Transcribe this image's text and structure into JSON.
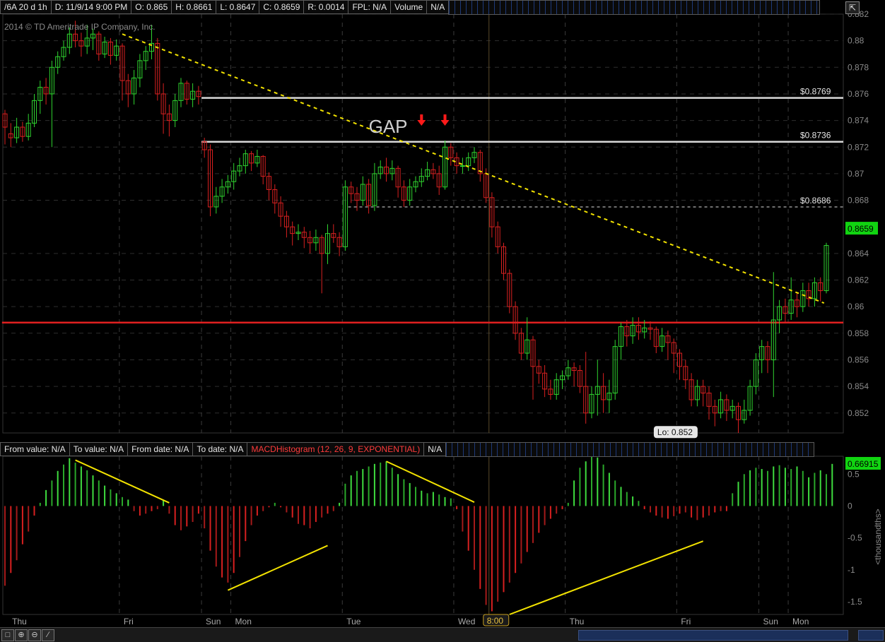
{
  "header": {
    "symbol": "/6A 20 d 1h",
    "date": "D: 11/9/14 9:00 PM",
    "open": "O: 0.865",
    "high": "H: 0.8661",
    "low": "L: 0.8647",
    "close": "C: 0.8659",
    "range": "R: 0.0014",
    "fpl": "FPL: N/A",
    "volume": "Volume",
    "volume_value": "N/A"
  },
  "copyright": "2014 © TD Ameritrade IP Company, Inc.",
  "lower_header": {
    "from_value": "From value: N/A",
    "to_value": "To value: N/A",
    "from_date": "From date: N/A",
    "to_date": "To date: N/A",
    "study": "MACDHistogram (12, 26, 9, EXPONENTIAL)",
    "na": "N/A"
  },
  "chart_data": [
    {
      "type": "candlestick",
      "price_axis": {
        "min": 0.8505,
        "max": 0.882,
        "ticks": [
          0.852,
          0.854,
          0.856,
          0.858,
          0.86,
          0.862,
          0.864,
          0.868,
          0.87,
          0.872,
          0.874,
          0.876,
          0.878,
          0.88,
          0.882
        ]
      },
      "last_price_label": "0.8659",
      "last_price": 0.8659,
      "x_labels": [
        {
          "label": "Thu",
          "i": 1
        },
        {
          "label": "Fri",
          "i": 20
        },
        {
          "label": "Sun",
          "i": 34
        },
        {
          "label": "Mon",
          "i": 39
        },
        {
          "label": "Tue",
          "i": 58
        },
        {
          "label": "Wed",
          "i": 77
        },
        {
          "label": "Thu",
          "i": 96
        },
        {
          "label": "Fri",
          "i": 115
        },
        {
          "label": "Sun",
          "i": 129
        },
        {
          "label": "Mon",
          "i": 134
        }
      ],
      "time_marker": {
        "label": "8:00",
        "i": 83
      },
      "day_separators": [
        20,
        34,
        39,
        58,
        77,
        96,
        115,
        129,
        134
      ],
      "levels": [
        {
          "label": "$0.8769",
          "value": 0.8757,
          "from_i": 34,
          "style": "solid",
          "color": "#d8d8d8"
        },
        {
          "label": "$0.8736",
          "value": 0.8724,
          "from_i": 34,
          "style": "solid",
          "color": "#d8d8d8"
        },
        {
          "label": "$0.8686",
          "value": 0.8675,
          "from_i": 59,
          "style": "dashed",
          "color": "#e0e0e0"
        },
        {
          "label": "",
          "value": 0.8588,
          "from_i": 0,
          "style": "solid",
          "color": "#e02020"
        }
      ],
      "trendline": {
        "i1": 20,
        "v1": 0.8805,
        "i2": 136,
        "v2": 0.8608,
        "color": "#f2e200"
      },
      "annotations": [
        {
          "text": "GAP",
          "i": 62,
          "value": 0.8735
        },
        {
          "text": "Lo: 0.852",
          "i": 113,
          "value": 0.8507
        }
      ],
      "arrows": [
        {
          "i": 71,
          "value": 0.8735
        },
        {
          "i": 75,
          "value": 0.8735
        }
      ],
      "candles": [
        [
          0.8745,
          0.8735,
          0.8748,
          0.8722
        ],
        [
          0.873,
          0.8727,
          0.8738,
          0.872
        ],
        [
          0.8727,
          0.8735,
          0.8742,
          0.8723
        ],
        [
          0.8735,
          0.8728,
          0.8739,
          0.8724
        ],
        [
          0.8728,
          0.8738,
          0.8745,
          0.8725
        ],
        [
          0.8738,
          0.8755,
          0.876,
          0.8735
        ],
        [
          0.8755,
          0.8765,
          0.877,
          0.8745
        ],
        [
          0.8765,
          0.876,
          0.8772,
          0.8752
        ],
        [
          0.876,
          0.878,
          0.8785,
          0.872
        ],
        [
          0.878,
          0.8788,
          0.8792,
          0.8775
        ],
        [
          0.8788,
          0.8795,
          0.88,
          0.8785
        ],
        [
          0.8795,
          0.8805,
          0.881,
          0.879
        ],
        [
          0.8805,
          0.88,
          0.8815,
          0.8795
        ],
        [
          0.88,
          0.8796,
          0.8806,
          0.8788
        ],
        [
          0.8796,
          0.8802,
          0.8812,
          0.879
        ],
        [
          0.8802,
          0.8805,
          0.8809,
          0.8793
        ],
        [
          0.8805,
          0.879,
          0.8807,
          0.8785
        ],
        [
          0.879,
          0.8799,
          0.8803,
          0.8787
        ],
        [
          0.8799,
          0.8789,
          0.8802,
          0.8782
        ],
        [
          0.8789,
          0.8796,
          0.8801,
          0.8785
        ],
        [
          0.8796,
          0.877,
          0.8798,
          0.8755
        ],
        [
          0.877,
          0.876,
          0.8775,
          0.875
        ],
        [
          0.876,
          0.8772,
          0.8778,
          0.8752
        ],
        [
          0.8772,
          0.8785,
          0.879,
          0.8765
        ],
        [
          0.8785,
          0.8792,
          0.8796,
          0.8778
        ],
        [
          0.8792,
          0.8798,
          0.8812,
          0.8786
        ],
        [
          0.8798,
          0.876,
          0.8802,
          0.8755
        ],
        [
          0.876,
          0.8745,
          0.8768,
          0.873
        ],
        [
          0.8745,
          0.874,
          0.8752,
          0.8728
        ],
        [
          0.874,
          0.8755,
          0.876,
          0.8735
        ],
        [
          0.8755,
          0.8768,
          0.8772,
          0.875
        ],
        [
          0.8768,
          0.8756,
          0.877,
          0.8752
        ],
        [
          0.8756,
          0.8762,
          0.8768,
          0.875
        ],
        [
          0.8762,
          0.8758,
          0.8766,
          0.8752
        ],
        [
          0.8724,
          0.8718,
          0.8727,
          0.8712
        ],
        [
          0.8718,
          0.8675,
          0.8722,
          0.8668
        ],
        [
          0.8675,
          0.8683,
          0.869,
          0.867
        ],
        [
          0.8683,
          0.869,
          0.8696,
          0.8678
        ],
        [
          0.869,
          0.8694,
          0.8699,
          0.8685
        ],
        [
          0.8694,
          0.8702,
          0.8708,
          0.8688
        ],
        [
          0.8702,
          0.8706,
          0.8712,
          0.8698
        ],
        [
          0.8706,
          0.8715,
          0.8718,
          0.87
        ],
        [
          0.8715,
          0.8708,
          0.8717,
          0.8702
        ],
        [
          0.8708,
          0.8713,
          0.8718,
          0.8705
        ],
        [
          0.8713,
          0.8698,
          0.8714,
          0.8692
        ],
        [
          0.8698,
          0.8688,
          0.8701,
          0.868
        ],
        [
          0.8688,
          0.8678,
          0.8692,
          0.867
        ],
        [
          0.8678,
          0.8668,
          0.8683,
          0.866
        ],
        [
          0.8668,
          0.866,
          0.8672,
          0.8652
        ],
        [
          0.866,
          0.8655,
          0.8664,
          0.8646
        ],
        [
          0.8655,
          0.8656,
          0.8662,
          0.865
        ],
        [
          0.8656,
          0.8652,
          0.866,
          0.8644
        ],
        [
          0.8652,
          0.8648,
          0.8657,
          0.864
        ],
        [
          0.8648,
          0.8652,
          0.8658,
          0.8642
        ],
        [
          0.8652,
          0.864,
          0.8654,
          0.861
        ],
        [
          0.864,
          0.8655,
          0.8662,
          0.8632
        ],
        [
          0.8655,
          0.8652,
          0.8662,
          0.8648
        ],
        [
          0.8652,
          0.8645,
          0.8656,
          0.8638
        ],
        [
          0.8645,
          0.869,
          0.8695,
          0.8642
        ],
        [
          0.869,
          0.8685,
          0.8694,
          0.8678
        ],
        [
          0.8685,
          0.868,
          0.869,
          0.8672
        ],
        [
          0.868,
          0.8692,
          0.8698,
          0.8676
        ],
        [
          0.8692,
          0.8676,
          0.8696,
          0.867
        ],
        [
          0.8676,
          0.87,
          0.8708,
          0.8672
        ],
        [
          0.87,
          0.8705,
          0.871,
          0.8696
        ],
        [
          0.8705,
          0.87,
          0.8712,
          0.8694
        ],
        [
          0.87,
          0.8704,
          0.871,
          0.8695
        ],
        [
          0.8704,
          0.869,
          0.8706,
          0.8682
        ],
        [
          0.869,
          0.868,
          0.8695,
          0.8675
        ],
        [
          0.868,
          0.869,
          0.8696,
          0.8676
        ],
        [
          0.869,
          0.8694,
          0.8698,
          0.8686
        ],
        [
          0.8694,
          0.8698,
          0.8704,
          0.869
        ],
        [
          0.8698,
          0.8703,
          0.8709,
          0.8695
        ],
        [
          0.8703,
          0.87,
          0.8708,
          0.8696
        ],
        [
          0.87,
          0.869,
          0.8706,
          0.8684
        ],
        [
          0.869,
          0.872,
          0.8725,
          0.8688
        ],
        [
          0.872,
          0.8712,
          0.8723,
          0.8706
        ],
        [
          0.8712,
          0.8706,
          0.8716,
          0.87
        ],
        [
          0.8706,
          0.8706,
          0.8712,
          0.87
        ],
        [
          0.8706,
          0.8712,
          0.8716,
          0.8702
        ],
        [
          0.8712,
          0.8716,
          0.872,
          0.8708
        ],
        [
          0.8716,
          0.87,
          0.8718,
          0.8694
        ],
        [
          0.87,
          0.8682,
          0.8704,
          0.8678
        ],
        [
          0.8682,
          0.866,
          0.8686,
          0.8652
        ],
        [
          0.866,
          0.8645,
          0.8664,
          0.864
        ],
        [
          0.8645,
          0.8625,
          0.8648,
          0.862
        ],
        [
          0.8625,
          0.86,
          0.8628,
          0.8595
        ],
        [
          0.86,
          0.858,
          0.8604,
          0.8575
        ],
        [
          0.858,
          0.8565,
          0.8584,
          0.856
        ],
        [
          0.8565,
          0.8575,
          0.8592,
          0.856
        ],
        [
          0.8575,
          0.8555,
          0.8578,
          0.853
        ],
        [
          0.8555,
          0.855,
          0.856,
          0.8542
        ],
        [
          0.855,
          0.8538,
          0.8556,
          0.8532
        ],
        [
          0.8538,
          0.8534,
          0.8545,
          0.853
        ],
        [
          0.8534,
          0.8545,
          0.855,
          0.853
        ],
        [
          0.8545,
          0.8548,
          0.8552,
          0.8538
        ],
        [
          0.8548,
          0.8554,
          0.856,
          0.8545
        ],
        [
          0.8554,
          0.8552,
          0.8558,
          0.854
        ],
        [
          0.8552,
          0.854,
          0.8556,
          0.8535
        ],
        [
          0.854,
          0.852,
          0.8566,
          0.8512
        ],
        [
          0.852,
          0.8534,
          0.854,
          0.8516
        ],
        [
          0.8534,
          0.854,
          0.856,
          0.8518
        ],
        [
          0.854,
          0.853,
          0.855,
          0.852
        ],
        [
          0.853,
          0.8535,
          0.8545,
          0.852
        ],
        [
          0.8535,
          0.857,
          0.8575,
          0.853
        ],
        [
          0.857,
          0.8585,
          0.8588,
          0.856
        ],
        [
          0.8585,
          0.8578,
          0.859,
          0.857
        ],
        [
          0.8578,
          0.8586,
          0.8592,
          0.8572
        ],
        [
          0.8586,
          0.8581,
          0.8592,
          0.8575
        ],
        [
          0.8581,
          0.8584,
          0.859,
          0.8576
        ],
        [
          0.8584,
          0.8583,
          0.8589,
          0.8575
        ],
        [
          0.8583,
          0.857,
          0.8585,
          0.8565
        ],
        [
          0.857,
          0.8578,
          0.8584,
          0.8566
        ],
        [
          0.8578,
          0.8573,
          0.8582,
          0.856
        ],
        [
          0.8573,
          0.8565,
          0.8576,
          0.855
        ],
        [
          0.8565,
          0.8555,
          0.8568,
          0.8545
        ],
        [
          0.8555,
          0.8545,
          0.856,
          0.8538
        ],
        [
          0.8545,
          0.853,
          0.855,
          0.8525
        ],
        [
          0.853,
          0.854,
          0.8545,
          0.8525
        ],
        [
          0.854,
          0.8535,
          0.8545,
          0.8525
        ],
        [
          0.8535,
          0.8525,
          0.854,
          0.8515
        ],
        [
          0.8525,
          0.852,
          0.853,
          0.851
        ],
        [
          0.852,
          0.853,
          0.8536,
          0.8516
        ],
        [
          0.853,
          0.8522,
          0.8534,
          0.8514
        ],
        [
          0.8522,
          0.8525,
          0.853,
          0.8516
        ],
        [
          0.8525,
          0.8515,
          0.8528,
          0.8505
        ],
        [
          0.8515,
          0.8522,
          0.853,
          0.8512
        ],
        [
          0.8522,
          0.854,
          0.8545,
          0.8518
        ],
        [
          0.854,
          0.856,
          0.8565,
          0.8534
        ],
        [
          0.856,
          0.857,
          0.8575,
          0.855
        ],
        [
          0.857,
          0.856,
          0.8574,
          0.855
        ],
        [
          0.856,
          0.859,
          0.8626,
          0.8532
        ],
        [
          0.859,
          0.86,
          0.8605,
          0.858
        ],
        [
          0.86,
          0.8595,
          0.8606,
          0.8588
        ],
        [
          0.8595,
          0.8605,
          0.8622,
          0.859
        ],
        [
          0.8605,
          0.86,
          0.861,
          0.8592
        ],
        [
          0.86,
          0.8612,
          0.8618,
          0.8596
        ],
        [
          0.8612,
          0.8606,
          0.8618,
          0.86
        ],
        [
          0.8606,
          0.8618,
          0.8622,
          0.86
        ],
        [
          0.8618,
          0.8612,
          0.8622,
          0.8604
        ],
        [
          0.8612,
          0.8646,
          0.8648,
          0.861
        ]
      ]
    },
    {
      "type": "bar",
      "title": "MACDHistogram (12, 26, 9, EXPONENTIAL)",
      "ylabel": "<thousandths>",
      "ylim": [
        -1.7,
        0.78
      ],
      "ticks": [
        0.5,
        0,
        -0.5,
        -1,
        -1.5
      ],
      "last_value_label": "0.66915",
      "last_value": 0.66915,
      "values": [
        -1.25,
        -1.05,
        -0.85,
        -0.6,
        -0.4,
        -0.15,
        0.05,
        0.25,
        0.4,
        0.55,
        0.65,
        0.75,
        0.68,
        0.62,
        0.56,
        0.48,
        0.4,
        0.32,
        0.26,
        0.2,
        0.14,
        0.1,
        -0.08,
        -0.15,
        -0.12,
        -0.08,
        -0.05,
        0.1,
        -0.12,
        -0.3,
        -0.38,
        -0.32,
        -0.25,
        -0.12,
        -0.35,
        -0.7,
        -0.95,
        -1.12,
        -1.2,
        -1.05,
        -0.8,
        -0.55,
        -0.3,
        -0.15,
        -0.08,
        -0.02,
        0.05,
        -0.02,
        -0.1,
        -0.18,
        -0.28,
        -0.3,
        -0.35,
        -0.25,
        -0.18,
        -0.12,
        -0.08,
        0.05,
        0.35,
        0.48,
        0.55,
        0.58,
        0.62,
        0.66,
        0.68,
        0.7,
        0.6,
        0.5,
        0.42,
        0.36,
        0.3,
        0.24,
        0.2,
        0.22,
        0.18,
        0.14,
        0.12,
        -0.05,
        -0.4,
        -0.7,
        -1.0,
        -1.3,
        -1.55,
        -1.65,
        -1.5,
        -1.35,
        -1.2,
        -1.05,
        -0.9,
        -0.72,
        -0.58,
        -0.42,
        -0.3,
        -0.2,
        -0.12,
        -0.05,
        0.05,
        0.4,
        0.6,
        0.7,
        0.78,
        0.76,
        0.65,
        0.52,
        0.4,
        0.3,
        0.22,
        0.15,
        0.08,
        -0.05,
        -0.1,
        -0.15,
        -0.18,
        -0.2,
        -0.16,
        -0.12,
        -0.1,
        -0.18,
        -0.22,
        -0.18,
        -0.15,
        -0.1,
        -0.08,
        -0.08,
        0.2,
        0.38,
        0.5,
        0.56,
        0.6,
        0.58,
        0.55,
        0.62,
        0.64,
        0.6,
        0.58,
        0.62,
        0.55,
        0.45,
        0.52,
        0.56,
        0.5,
        0.66
      ]
    }
  ]
}
